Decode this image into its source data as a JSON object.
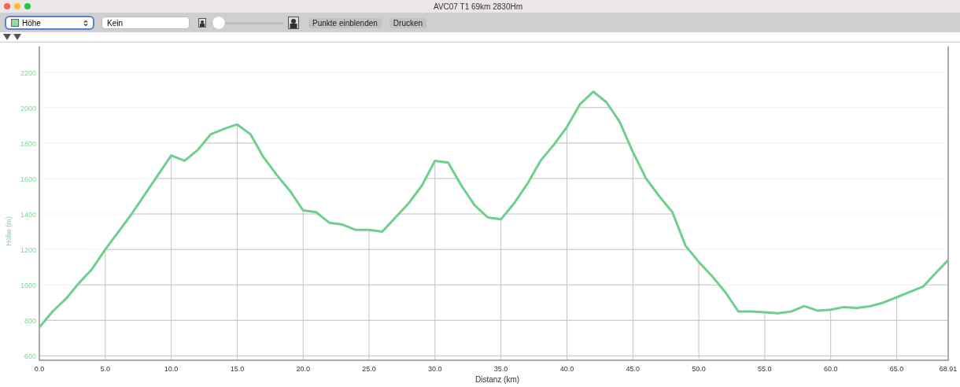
{
  "window": {
    "title": "AVC07 T1 69km 2830Hm"
  },
  "toolbar": {
    "series_select": {
      "value": "Höhe"
    },
    "compare_select": {
      "value": "Kein"
    },
    "zoom_slider": {
      "level": 0.03
    },
    "buttons": [
      "Punkte einblenden",
      "Drucken"
    ]
  },
  "chart": {
    "chart_data": {
      "type": "line",
      "xlabel": "Distanz (km)",
      "ylabel": "Höhe (m)",
      "x": [
        0,
        1,
        2,
        3,
        4,
        5,
        6,
        7,
        8,
        9,
        10,
        11,
        12,
        13,
        14,
        15,
        16,
        17,
        18,
        19,
        20,
        21,
        22,
        23,
        24,
        25,
        26,
        27,
        28,
        29,
        30,
        31,
        32,
        33,
        34,
        35,
        36,
        37,
        38,
        39,
        40,
        41,
        42,
        43,
        44,
        45,
        46,
        47,
        48,
        49,
        50,
        51,
        52,
        53,
        54,
        55,
        56,
        57,
        58,
        59,
        60,
        61,
        62,
        63,
        64,
        65,
        66,
        67,
        68,
        68.91
      ],
      "series": [
        {
          "color": "#6fcf8e",
          "values": [
            760,
            850,
            920,
            1010,
            1090,
            1200,
            1300,
            1400,
            1510,
            1620,
            1730,
            1700,
            1760,
            1850,
            1880,
            1905,
            1850,
            1720,
            1620,
            1530,
            1420,
            1410,
            1350,
            1340,
            1310,
            1310,
            1300,
            1380,
            1460,
            1560,
            1700,
            1690,
            1560,
            1450,
            1380,
            1370,
            1460,
            1570,
            1700,
            1790,
            1890,
            2020,
            2090,
            2030,
            1920,
            1750,
            1600,
            1500,
            1410,
            1220,
            1130,
            1050,
            960,
            850,
            850,
            845,
            840,
            850,
            880,
            855,
            860,
            875,
            870,
            880,
            900,
            930,
            960,
            990,
            1070,
            1140
          ]
        }
      ],
      "grid": true,
      "xlim": [
        0,
        68.91
      ],
      "ylim": [
        575,
        2345
      ],
      "xticks": [
        {
          "value": 0,
          "label": "0.0"
        },
        {
          "value": 5,
          "label": "5.0"
        },
        {
          "value": 10,
          "label": "10.0"
        },
        {
          "value": 15,
          "label": "15.0"
        },
        {
          "value": 20,
          "label": "20.0"
        },
        {
          "value": 25,
          "label": "25.0"
        },
        {
          "value": 30,
          "label": "30.0"
        },
        {
          "value": 35,
          "label": "35.0"
        },
        {
          "value": 40,
          "label": "40.0"
        },
        {
          "value": 45,
          "label": "45.0"
        },
        {
          "value": 50,
          "label": "50.0"
        },
        {
          "value": 55,
          "label": "55.0"
        },
        {
          "value": 60,
          "label": "60.0"
        },
        {
          "value": 65,
          "label": "65.0"
        },
        {
          "value": 68.91,
          "label": "68.91"
        }
      ],
      "yticks": [
        600,
        800,
        1000,
        1200,
        1400,
        1600,
        1800,
        2000,
        2200
      ]
    }
  }
}
